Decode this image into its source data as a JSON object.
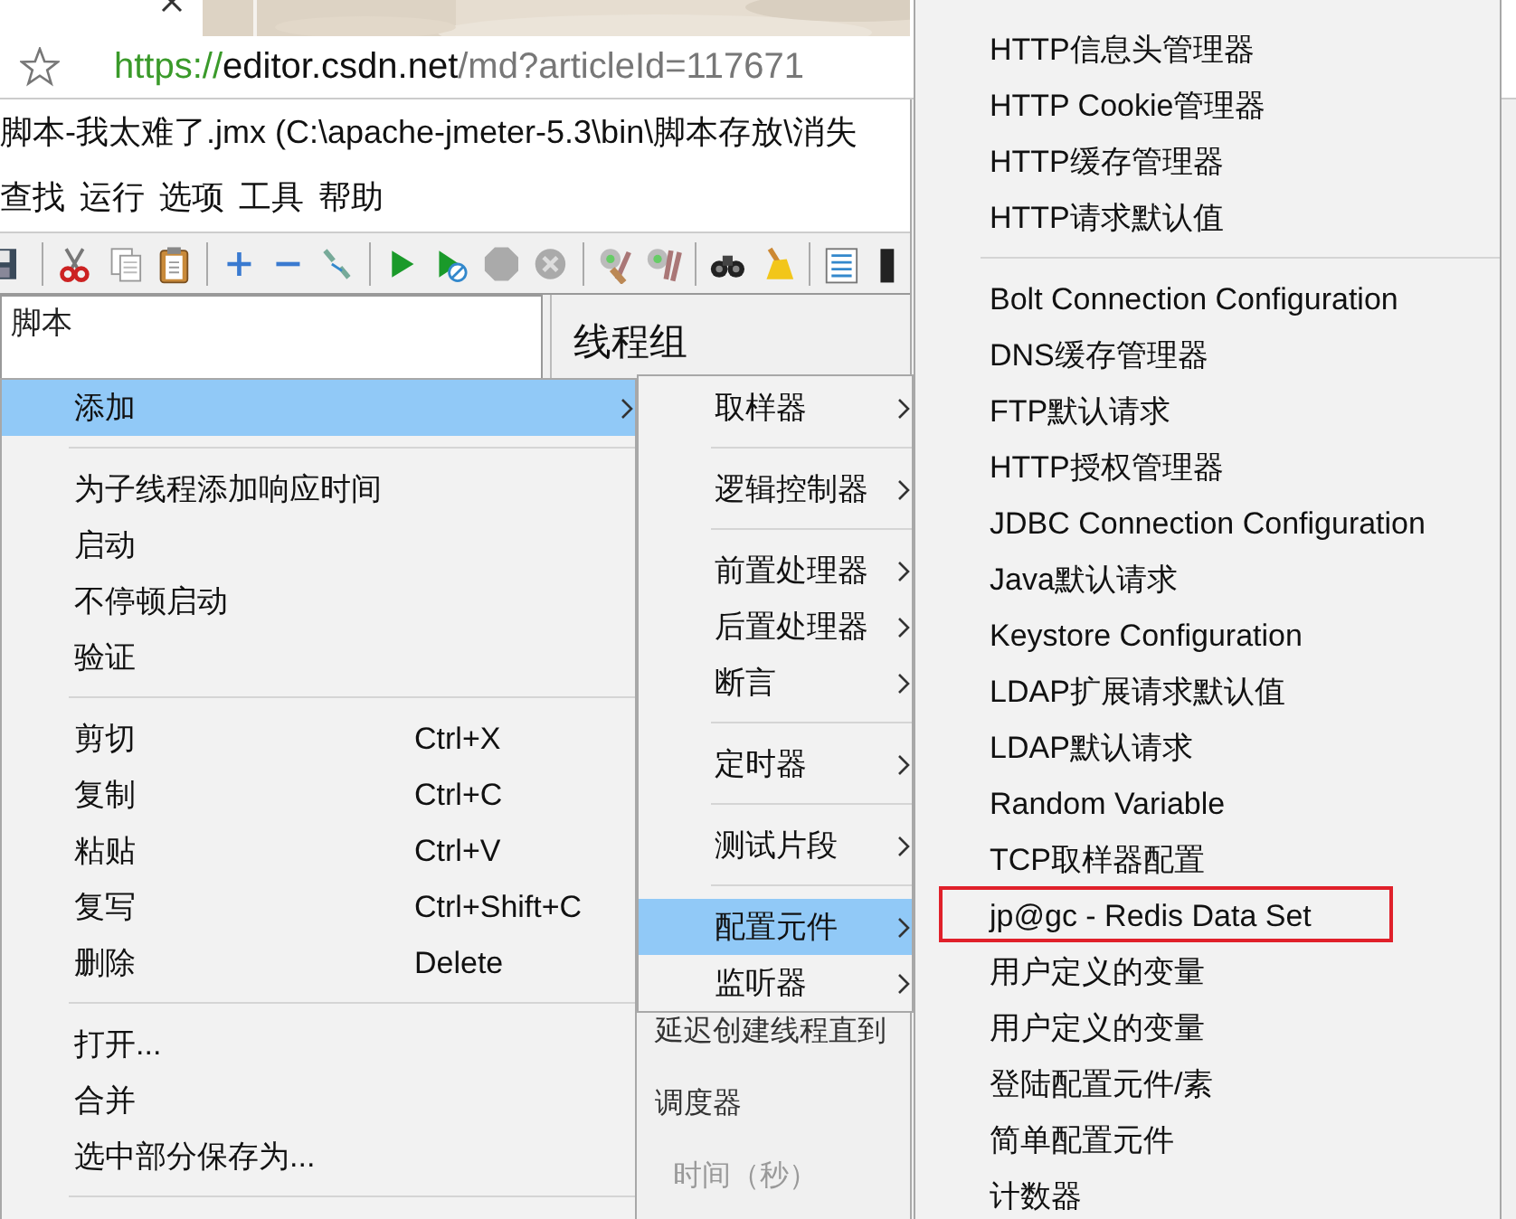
{
  "browser": {
    "url": {
      "scheme": "https://",
      "host": "editor.csdn.net",
      "path": "/md?articleId=117671"
    }
  },
  "window": {
    "title": "脚本-我太难了.jmx (C:\\apache-jmeter-5.3\\bin\\脚本存放\\消失"
  },
  "menubar": [
    "查找",
    "运行",
    "选项",
    "工具",
    "帮助"
  ],
  "tree": [
    {
      "label": "脚本",
      "selected": false
    }
  ],
  "panel": {
    "heading": "线程组",
    "fields": [
      {
        "label": "延迟创建线程直到",
        "disabled": false
      },
      {
        "label": "调度器",
        "disabled": false
      },
      {
        "label": "时间（秒）",
        "disabled": true
      }
    ]
  },
  "context_menu": {
    "items": [
      {
        "kind": "item",
        "label": "添加",
        "submenu": true,
        "selected": true
      },
      {
        "kind": "separator"
      },
      {
        "kind": "item",
        "label": "为子线程添加响应时间",
        "submenu": false,
        "selected": false
      },
      {
        "kind": "item",
        "label": "启动",
        "submenu": false,
        "selected": false
      },
      {
        "kind": "item",
        "label": "不停顿启动",
        "submenu": false,
        "selected": false
      },
      {
        "kind": "item",
        "label": "验证",
        "submenu": false,
        "selected": false
      },
      {
        "kind": "separator"
      },
      {
        "kind": "item",
        "label": "剪切",
        "shortcut": "Ctrl+X",
        "submenu": false,
        "selected": false
      },
      {
        "kind": "item",
        "label": "复制",
        "shortcut": "Ctrl+C",
        "submenu": false,
        "selected": false
      },
      {
        "kind": "item",
        "label": "粘贴",
        "shortcut": "Ctrl+V",
        "submenu": false,
        "selected": false
      },
      {
        "kind": "item",
        "label": "复写",
        "shortcut": "Ctrl+Shift+C",
        "submenu": false,
        "selected": false
      },
      {
        "kind": "item",
        "label": "删除",
        "shortcut": "Delete",
        "submenu": false,
        "selected": false
      },
      {
        "kind": "separator"
      },
      {
        "kind": "item",
        "label": "打开...",
        "submenu": false,
        "selected": false
      },
      {
        "kind": "item",
        "label": "合并",
        "submenu": false,
        "selected": false
      },
      {
        "kind": "item",
        "label": "选中部分保存为...",
        "submenu": false,
        "selected": false
      },
      {
        "kind": "separator"
      }
    ]
  },
  "add_submenu": {
    "items": [
      {
        "kind": "item",
        "label": "取样器",
        "submenu": true,
        "selected": false
      },
      {
        "kind": "separator"
      },
      {
        "kind": "item",
        "label": "逻辑控制器",
        "submenu": true,
        "selected": false
      },
      {
        "kind": "separator"
      },
      {
        "kind": "item",
        "label": "前置处理器",
        "submenu": true,
        "selected": false
      },
      {
        "kind": "item",
        "label": "后置处理器",
        "submenu": true,
        "selected": false
      },
      {
        "kind": "item",
        "label": "断言",
        "submenu": true,
        "selected": false
      },
      {
        "kind": "separator"
      },
      {
        "kind": "item",
        "label": "定时器",
        "submenu": true,
        "selected": false
      },
      {
        "kind": "separator"
      },
      {
        "kind": "item",
        "label": "测试片段",
        "submenu": true,
        "selected": false
      },
      {
        "kind": "separator"
      },
      {
        "kind": "item",
        "label": "配置元件",
        "submenu": true,
        "selected": true
      },
      {
        "kind": "item",
        "label": "监听器",
        "submenu": true,
        "selected": false
      }
    ]
  },
  "config_submenu": {
    "items": [
      {
        "kind": "item",
        "label": "HTTP信息头管理器",
        "selected": false,
        "annotated": false
      },
      {
        "kind": "item",
        "label": "HTTP Cookie管理器",
        "selected": false,
        "annotated": false
      },
      {
        "kind": "item",
        "label": "HTTP缓存管理器",
        "selected": false,
        "annotated": false
      },
      {
        "kind": "item",
        "label": "HTTP请求默认值",
        "selected": false,
        "annotated": false
      },
      {
        "kind": "separator"
      },
      {
        "kind": "item",
        "label": "Bolt Connection Configuration",
        "selected": false,
        "annotated": false
      },
      {
        "kind": "item",
        "label": "DNS缓存管理器",
        "selected": false,
        "annotated": false
      },
      {
        "kind": "item",
        "label": "FTP默认请求",
        "selected": false,
        "annotated": false
      },
      {
        "kind": "item",
        "label": "HTTP授权管理器",
        "selected": false,
        "annotated": false
      },
      {
        "kind": "item",
        "label": "JDBC Connection Configuration",
        "selected": false,
        "annotated": false
      },
      {
        "kind": "item",
        "label": "Java默认请求",
        "selected": false,
        "annotated": false
      },
      {
        "kind": "item",
        "label": "Keystore Configuration",
        "selected": false,
        "annotated": false
      },
      {
        "kind": "item",
        "label": "LDAP扩展请求默认值",
        "selected": false,
        "annotated": false
      },
      {
        "kind": "item",
        "label": "LDAP默认请求",
        "selected": false,
        "annotated": false
      },
      {
        "kind": "item",
        "label": "Random Variable",
        "selected": false,
        "annotated": false
      },
      {
        "kind": "item",
        "label": "TCP取样器配置",
        "selected": false,
        "annotated": false
      },
      {
        "kind": "item",
        "label": "jp@gc - Redis Data Set",
        "selected": false,
        "annotated": true
      },
      {
        "kind": "item",
        "label": "用户定义的变量",
        "selected": false,
        "annotated": false
      },
      {
        "kind": "item",
        "label": "用户定义的变量",
        "selected": false,
        "annotated": false
      },
      {
        "kind": "item",
        "label": "登陆配置元件/素",
        "selected": false,
        "annotated": false
      },
      {
        "kind": "item",
        "label": "简单配置元件",
        "selected": false,
        "annotated": false
      },
      {
        "kind": "item",
        "label": "计数器",
        "selected": false,
        "annotated": false
      }
    ]
  }
}
